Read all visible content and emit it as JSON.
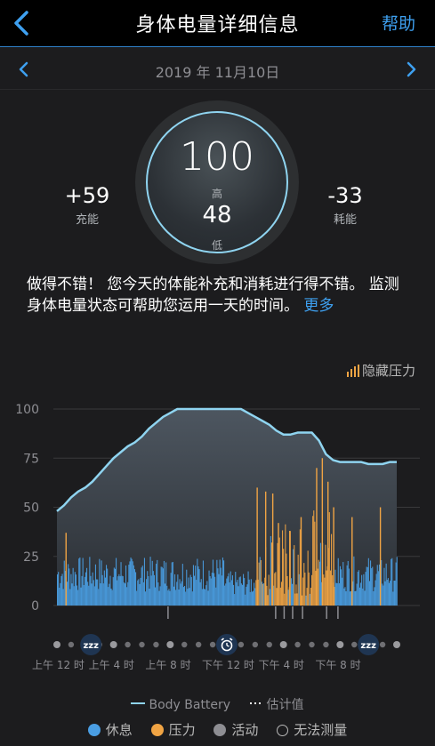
{
  "header": {
    "title": "身体电量详细信息",
    "help_label": "帮助",
    "back_icon": "chevron-left-icon"
  },
  "date_nav": {
    "date": "2019 年 11月10日",
    "prev_icon": "chevron-left-icon",
    "next_icon": "chevron-right-icon"
  },
  "gauge": {
    "high_value": "100",
    "high_label": "高",
    "low_value": "48",
    "low_label": "低"
  },
  "charged": {
    "value": "+59",
    "label": "充能"
  },
  "drained": {
    "value": "-33",
    "label": "耗能"
  },
  "summary": {
    "text": "做得不错！ 您今天的体能补充和消耗进行得不错。 监测身体电量状态可帮助您运用一天的时间。",
    "more_link": "更多"
  },
  "stress_toggle": {
    "label": "隐藏压力",
    "icon": "stress-bars-icon"
  },
  "colors": {
    "accent": "#3ea0f0",
    "battery_line": "#8fd4f0",
    "rest": "#4a9ee3",
    "stress": "#f0a444",
    "activity": "#8e8e93"
  },
  "chart_data": {
    "type": "area",
    "y_ticks": [
      "100",
      "75",
      "50",
      "25",
      "0"
    ],
    "ylim": [
      0,
      100
    ],
    "xlim": [
      0,
      24
    ],
    "x_unit": "hour of day",
    "body_battery": {
      "x": [
        0,
        0.5,
        1,
        1.5,
        2,
        2.5,
        3,
        3.5,
        4,
        4.5,
        5,
        5.5,
        6,
        6.5,
        7,
        7.5,
        8,
        8.5,
        9,
        9.5,
        10,
        10.5,
        11,
        11.5,
        12,
        12.5,
        13,
        13.5,
        14,
        14.5,
        15,
        15.5,
        16,
        16.5,
        17,
        17.5,
        18,
        18.5,
        19,
        19.5,
        20,
        20.5,
        21,
        21.5,
        22,
        22.5,
        23,
        23.5,
        24
      ],
      "y": [
        48,
        51,
        55,
        58,
        60,
        63,
        67,
        71,
        75,
        78,
        81,
        83,
        86,
        90,
        93,
        96,
        98,
        100,
        100,
        100,
        100,
        100,
        100,
        100,
        100,
        100,
        100,
        98,
        96,
        94,
        92,
        89,
        87,
        87,
        88,
        88,
        88,
        84,
        77,
        74,
        73,
        73,
        73,
        73,
        72,
        72,
        72,
        73,
        73
      ]
    },
    "stress": {
      "segments": [
        {
          "from": 0,
          "to": 11.8,
          "kind": "rest",
          "level": 20
        },
        {
          "from": 11.8,
          "to": 14.0,
          "kind": "rest",
          "level": 14
        },
        {
          "from": 14.0,
          "to": 18.0,
          "kind": "stress",
          "level": 35
        },
        {
          "from": 18.0,
          "to": 19.6,
          "kind": "stress",
          "level": 42
        },
        {
          "from": 19.6,
          "to": 24,
          "kind": "rest",
          "level": 20
        }
      ],
      "spikes": [
        {
          "x": 0.6,
          "v": 37
        },
        {
          "x": 14.1,
          "v": 60
        },
        {
          "x": 14.7,
          "v": 58
        },
        {
          "x": 15.2,
          "v": 57
        },
        {
          "x": 15.6,
          "v": 42
        },
        {
          "x": 16.4,
          "v": 38
        },
        {
          "x": 17.2,
          "v": 45
        },
        {
          "x": 18.3,
          "v": 70
        },
        {
          "x": 18.7,
          "v": 75
        },
        {
          "x": 19.1,
          "v": 63
        },
        {
          "x": 19.5,
          "v": 50
        },
        {
          "x": 20.8,
          "v": 45
        },
        {
          "x": 22.8,
          "v": 50
        }
      ]
    },
    "series": [
      {
        "name": "Body Battery",
        "style": "solid line"
      },
      {
        "name": "估计值",
        "style": "dotted line"
      }
    ]
  },
  "timeline": {
    "labels": [
      "上午 12 时",
      "上午 4 时",
      "上午 8 时",
      "下午 12 时",
      "下午 4 时",
      "下午 8 时"
    ],
    "markers": [
      {
        "hour": 2.4,
        "icon": "sleep-zzz-icon"
      },
      {
        "hour": 12,
        "icon": "alarm-clock-icon"
      },
      {
        "hour": 22,
        "icon": "sleep-zzz-icon"
      }
    ]
  },
  "legend": {
    "line_items": [
      {
        "label": "Body Battery",
        "style": "solid"
      },
      {
        "label": "估计值",
        "style": "dotted"
      }
    ],
    "dot_items": [
      {
        "label": "休息",
        "color": "#4a9ee3"
      },
      {
        "label": "压力",
        "color": "#f0a444"
      },
      {
        "label": "活动",
        "color": "#8e8e93"
      },
      {
        "label": "无法测量",
        "color": "none"
      }
    ]
  }
}
